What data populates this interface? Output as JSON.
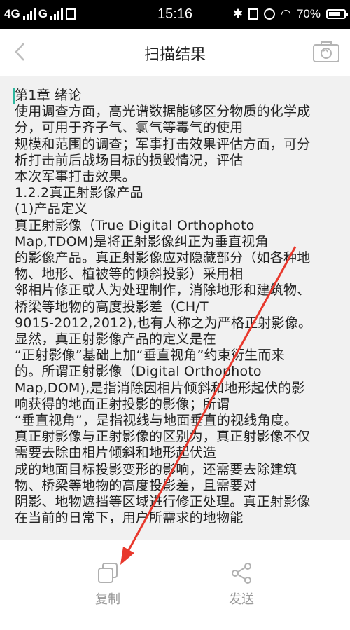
{
  "status_bar": {
    "carrier1": "4G",
    "carrier2": "G",
    "time": "15:16",
    "battery": "70%"
  },
  "header": {
    "title": "扫描结果"
  },
  "content": {
    "lines": [
      "第1章 绪论",
      "使用调查方面，高光谱数据能够区分物质的化学成",
      "分，可用于齐子气、氯气等毒气的使用",
      "规模和范围的调查；军事打击效果评估方面，可分",
      "析打击前后战场目标的损毁情况，评估",
      "本次军事打击效果。",
      "1.2.2真正射影像产品",
      "(1)产品定义",
      "真正射影像（True Digital Orthophoto",
      "Map,TDOM)是将正射影像纠正为垂直视角",
      "的影像产品。真正射影像应对隐藏部分（如各种地",
      "物、地形、植被等的倾斜投影）采用相",
      "邻相片修正或人为处理制作，消除地形和建筑物、",
      "桥梁等地物的高度投影差（CH/T",
      "9015-2012,2012),也有人称之为严格正射影像。",
      "显然，真正射影像产品的定义是在",
      "“正射影像”基础上加“垂直视角”约束衍生而来",
      "的。所谓正射影像（Digital Orthophoto",
      "Map,DOM),是指消除因相片倾斜和地形起伏的影",
      "响获得的地面正射投影的影像；所谓",
      "“垂直视角”，是指视线与地面垂直的视线角度。",
      "真正射影像与正射影像的区别为，真正射影像不仅",
      "需要去除由相片倾斜和地形起伏造",
      "成的地面目标投影变形的影响，还需要去除建筑",
      "物、桥梁等地物的高度投影差，且需要对",
      "阴影、地物遮挡等区域进行修正处理。真正射影像",
      "在当前的日常下，用户所需求的地物能"
    ]
  },
  "bottom_bar": {
    "copy_label": "复制",
    "send_label": "发送"
  },
  "colors": {
    "annotation_arrow": "#e8382c",
    "caret": "#2fb8a0"
  }
}
